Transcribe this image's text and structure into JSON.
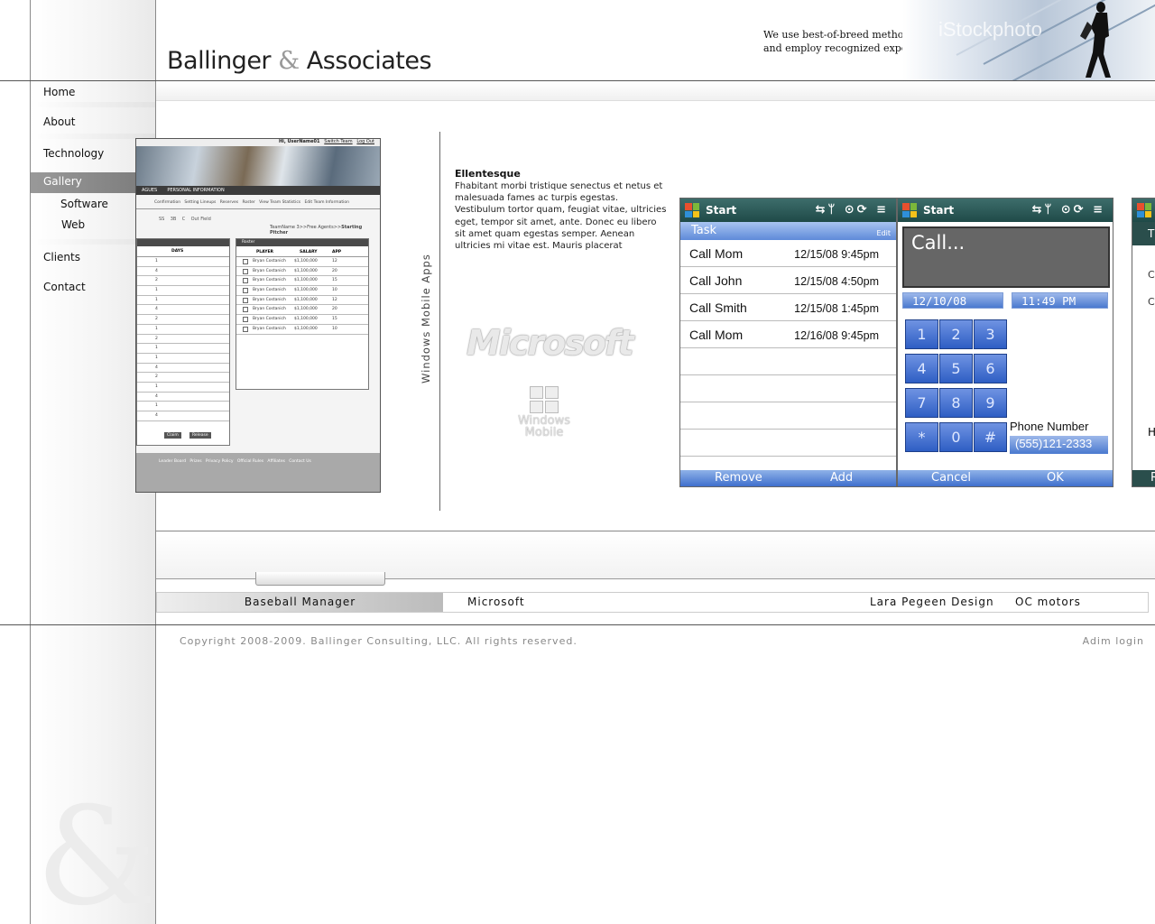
{
  "header": {
    "logo_left": "Ballinger",
    "logo_amp": "&",
    "logo_right": "Associates",
    "tagline_line1": "We use best-of-breed methodologies",
    "tagline_line2": "and employ recognized experts",
    "photo_watermark": "iStockphoto"
  },
  "nav": {
    "items": [
      {
        "label": "Home"
      },
      {
        "label": "About"
      },
      {
        "label": "Technology"
      },
      {
        "label": "Gallery"
      },
      {
        "label": "Clients"
      },
      {
        "label": "Contact"
      }
    ],
    "gallery_sub": [
      {
        "label": "Software"
      },
      {
        "label": "Web"
      }
    ],
    "active": "Gallery"
  },
  "baseball_shot": {
    "top_link1": "Hi, UserName01",
    "top_link2": "Switch Team",
    "top_link3": "Log Out",
    "nav1": "AGUES",
    "nav2": "PERSONAL INFORMATION",
    "tabs": [
      "Confirmation",
      "Setting Lineups",
      "Reserves",
      "Roster",
      "View Team Statistics",
      "Edit Team Information"
    ],
    "positions": [
      "SS",
      "3B",
      "C",
      "Out Field"
    ],
    "breadcrumb": "TeamName 3>>Free Agents>>",
    "breadcrumb_current": "Starting Pitcher",
    "left_col": "DAYS",
    "left_days": [
      "1",
      "4",
      "2",
      "1",
      "1",
      "4",
      "2",
      "1",
      "2",
      "1",
      "1",
      "4",
      "2",
      "1",
      "4",
      "1",
      "4"
    ],
    "roster_title": "Roster",
    "roster_cols": [
      "PLAYER",
      "SALARY",
      "APP"
    ],
    "roster_rows": [
      {
        "player": "Bryan Costanich",
        "salary": "$1,100,000",
        "app": "12"
      },
      {
        "player": "Bryan Costanich",
        "salary": "$1,100,000",
        "app": "20"
      },
      {
        "player": "Bryan Costanich",
        "salary": "$1,100,000",
        "app": "15"
      },
      {
        "player": "Bryan Costanich",
        "salary": "$1,100,000",
        "app": "10"
      },
      {
        "player": "Bryan Costanich",
        "salary": "$1,100,000",
        "app": "12"
      },
      {
        "player": "Bryan Costanich",
        "salary": "$1,100,000",
        "app": "20"
      },
      {
        "player": "Bryan Costanich",
        "salary": "$1,100,000",
        "app": "15"
      },
      {
        "player": "Bryan Costanich",
        "salary": "$1,100,000",
        "app": "10"
      }
    ],
    "btn_claim": "Claim",
    "btn_release": "Release",
    "footer_links": [
      "Leader Board",
      "Prizes",
      "Privacy Policy",
      "Official Rules",
      "Affiliates",
      "Contact Us"
    ]
  },
  "gallery": {
    "vertical_label": "Windows Mobile Apps",
    "article_title": "Ellentesque",
    "article_body": "Fhabitant morbi tristique senectus et netus et malesuada fames ac turpis egestas. Vestibulum tortor quam, feugiat vitae, ultricies eget, tempor sit amet, ante. Donec eu libero sit amet quam egestas semper. Aenean ultricies mi vitae est. Mauris placerat",
    "ms_logo": "Microsoft",
    "win_mobile_1": "Windows",
    "win_mobile_2": "Mobile"
  },
  "phone1": {
    "start": "Start",
    "task": "Task",
    "edit": "Edit",
    "calls": [
      {
        "name": "Call Mom",
        "date": "12/15/08 9:45pm"
      },
      {
        "name": "Call John",
        "date": "12/15/08 4:50pm"
      },
      {
        "name": "Call Smith",
        "date": "12/15/08 1:45pm"
      },
      {
        "name": "Call Mom",
        "date": "12/16/08 9:45pm"
      }
    ],
    "softkey_left": "Remove",
    "softkey_right": "Add"
  },
  "phone2": {
    "start": "Start",
    "call_text": "Call...",
    "date": "12/10/08",
    "time": "11:49 PM",
    "keys": [
      "1",
      "2",
      "3",
      "4",
      "5",
      "6",
      "7",
      "8",
      "9",
      "*",
      "0",
      "#"
    ],
    "phone_label": "Phone Number",
    "phone_value": "(555)121-2333",
    "softkey_left": "Cancel",
    "softkey_right": "OK"
  },
  "phone3": {
    "t": "T",
    "c1": "C",
    "c2": "C",
    "h": "H",
    "re": "Re"
  },
  "gallery_tabs": [
    {
      "label": "Baseball Manager"
    },
    {
      "label": "Microsoft"
    },
    {
      "label": "Lara Pegeen Design"
    },
    {
      "label": "OC motors"
    }
  ],
  "footer": {
    "copyright": "Copyright 2008-2009. Ballinger Consulting, LLC. All rights reserved.",
    "admin": "Adim login"
  }
}
